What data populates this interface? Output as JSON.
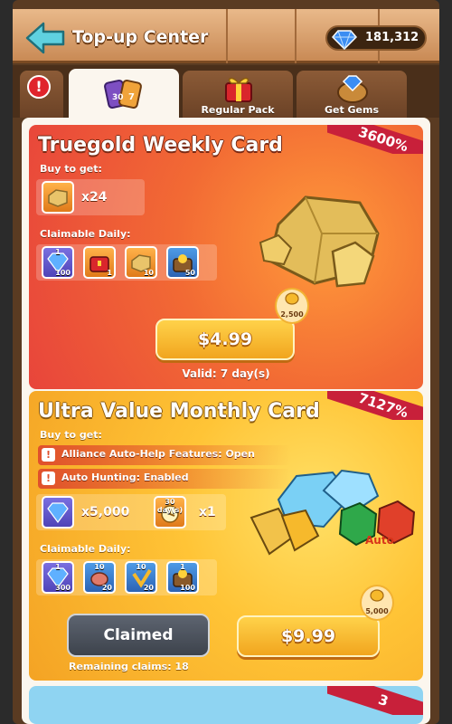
{
  "header": {
    "title": "Top-up Center",
    "gems": "181,312"
  },
  "tabs": [
    {
      "label": "",
      "icon": "cards-icon",
      "active": true
    },
    {
      "label": "Regular Pack",
      "icon": "gift-icon",
      "active": false
    },
    {
      "label": "Get Gems",
      "icon": "gem-bag-icon",
      "active": false
    }
  ],
  "alert": "!",
  "card1": {
    "title": "Truegold Weekly Card",
    "badge": "3600%",
    "buy_label": "Buy to get:",
    "buy_item_qty": "x24",
    "daily_label": "Claimable Daily:",
    "daily_items": [
      {
        "icon": "gem-icon",
        "top": "1",
        "qty": "100"
      },
      {
        "icon": "chest-icon",
        "top": "",
        "qty": "1"
      },
      {
        "icon": "truegold-icon",
        "top": "",
        "qty": "10"
      },
      {
        "icon": "treasure-icon",
        "top": "",
        "qty": "50"
      }
    ],
    "coins": "2,500",
    "price": "$4.99",
    "valid": "Valid: 7 day(s)"
  },
  "card2": {
    "title": "Ultra Value Monthly Card",
    "badge": "7127%",
    "buy_label": "Buy to get:",
    "features": [
      "Alliance Auto-Help Features: Open",
      "Auto Hunting: Enabled"
    ],
    "gem_qty": "x5,000",
    "pass_top": "30 day(s)",
    "pass_qty": "x1",
    "daily_label": "Claimable Daily:",
    "daily_items": [
      {
        "icon": "gem-icon",
        "top": "1",
        "qty": "300"
      },
      {
        "icon": "meat-icon",
        "top": "10",
        "qty": "20"
      },
      {
        "icon": "speedup-icon",
        "top": "10",
        "qty": "20"
      },
      {
        "icon": "treasure-icon",
        "top": "1",
        "qty": "100"
      }
    ],
    "claimed": "Claimed",
    "remaining": "Remaining claims: 18",
    "coins": "5,000",
    "price": "$9.99",
    "auto": "Auto"
  },
  "card3": {
    "badge": "3"
  },
  "colors": {
    "accent_orange": "#f1a51e",
    "ribbon_red": "#c8203a",
    "card1_bg": "#e8453b",
    "card2_bg": "#ffc436"
  }
}
